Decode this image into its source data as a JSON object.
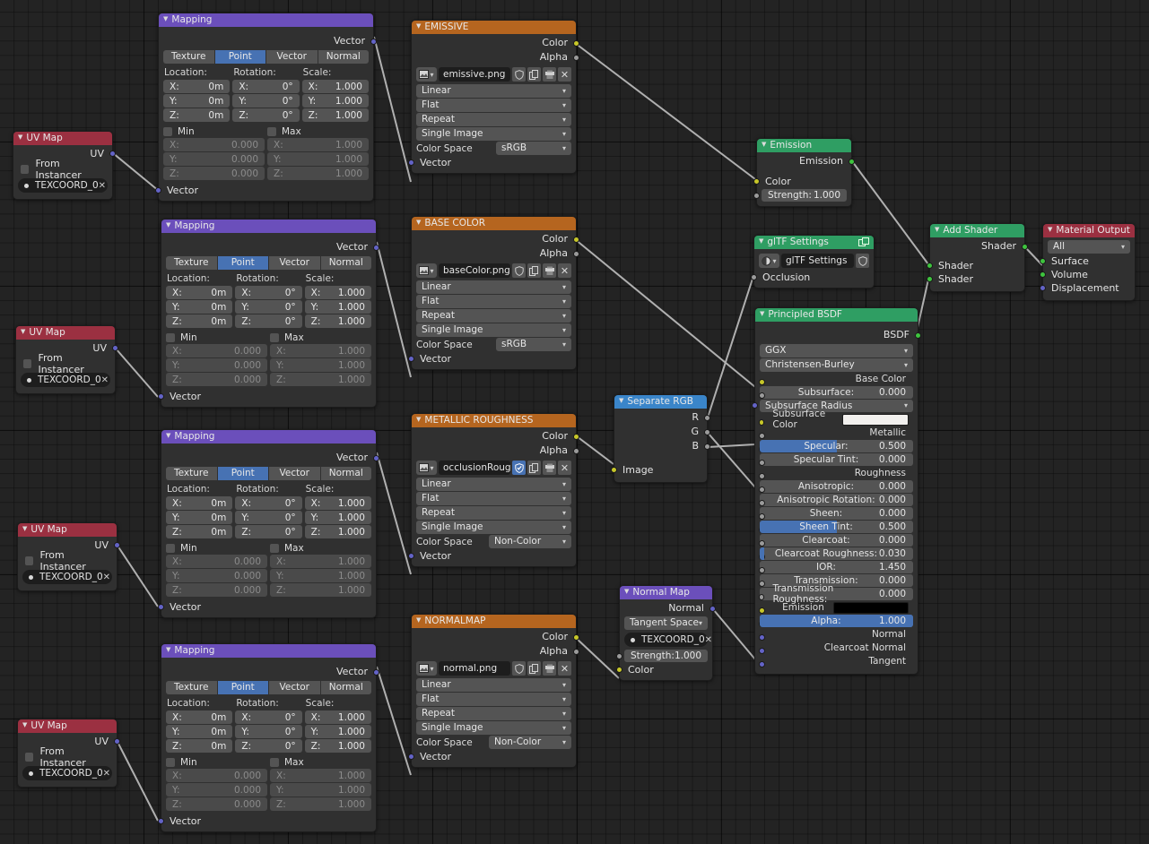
{
  "editor": {
    "name": "blender-shader-node-editor",
    "background": "#232323"
  },
  "colors": {
    "header_mapping": "#6b4fbb",
    "header_uvmap": "#9b3041",
    "header_texture": "#b5651f",
    "header_shader": "#2f9e63",
    "header_output": "#9b3041",
    "header_separate_rgb": "#3a85c9",
    "slider_fill": "#4772b3",
    "wire": "#b0b0b0",
    "socket_color": "#c7c729",
    "socket_value": "#9b9b9b",
    "socket_shader": "#3ec43e",
    "socket_vector": "#6363c7"
  },
  "labels": {
    "vector": "Vector",
    "uv": "UV",
    "color": "Color",
    "alpha": "Alpha",
    "image": "Image",
    "normal": "Normal",
    "shader": "Shader",
    "emission": "Emission",
    "occlusion": "Occlusion",
    "from_instancer": "From Instancer",
    "location": "Location:",
    "rotation": "Rotation:",
    "scale": "Scale:",
    "min": "Min",
    "max": "Max",
    "x": "X:",
    "y": "Y:",
    "z": "Z:",
    "r": "R",
    "g": "G",
    "b": "B",
    "color_space": "Color Space",
    "strength": "Strength:",
    "bsdf": "BSDF"
  },
  "mapping_nodes": [
    {
      "title": "Mapping",
      "tabs": [
        "Texture",
        "Point",
        "Vector",
        "Normal"
      ],
      "active_tab": "Point",
      "location": [
        "0m",
        "0m",
        "0m"
      ],
      "rotation": [
        "0°",
        "0°",
        "0°"
      ],
      "scale": [
        "1.000",
        "1.000",
        "1.000"
      ],
      "min_values": [
        "0.000",
        "0.000",
        "0.000"
      ],
      "max_values": [
        "1.000",
        "1.000",
        "1.000"
      ],
      "min_checked": false,
      "max_checked": false
    },
    {
      "title": "Mapping",
      "tabs": [
        "Texture",
        "Point",
        "Vector",
        "Normal"
      ],
      "active_tab": "Point",
      "location": [
        "0m",
        "0m",
        "0m"
      ],
      "rotation": [
        "0°",
        "0°",
        "0°"
      ],
      "scale": [
        "1.000",
        "1.000",
        "1.000"
      ],
      "min_values": [
        "0.000",
        "0.000",
        "0.000"
      ],
      "max_values": [
        "1.000",
        "1.000",
        "1.000"
      ],
      "min_checked": false,
      "max_checked": false
    },
    {
      "title": "Mapping",
      "tabs": [
        "Texture",
        "Point",
        "Vector",
        "Normal"
      ],
      "active_tab": "Point",
      "location": [
        "0m",
        "0m",
        "0m"
      ],
      "rotation": [
        "0°",
        "0°",
        "0°"
      ],
      "scale": [
        "1.000",
        "1.000",
        "1.000"
      ],
      "min_values": [
        "0.000",
        "0.000",
        "0.000"
      ],
      "max_values": [
        "1.000",
        "1.000",
        "1.000"
      ],
      "min_checked": false,
      "max_checked": false
    },
    {
      "title": "Mapping",
      "tabs": [
        "Texture",
        "Point",
        "Vector",
        "Normal"
      ],
      "active_tab": "Point",
      "location": [
        "0m",
        "0m",
        "0m"
      ],
      "rotation": [
        "0°",
        "0°",
        "0°"
      ],
      "scale": [
        "1.000",
        "1.000",
        "1.000"
      ],
      "min_values": [
        "0.000",
        "0.000",
        "0.000"
      ],
      "max_values": [
        "1.000",
        "1.000",
        "1.000"
      ],
      "min_checked": false,
      "max_checked": false
    }
  ],
  "uv_map_nodes": [
    {
      "title": "UV Map",
      "output": "UV",
      "from_instancer": "From Instancer",
      "uv_layer": "TEXCOORD_0"
    },
    {
      "title": "UV Map",
      "output": "UV",
      "from_instancer": "From Instancer",
      "uv_layer": "TEXCOORD_0"
    },
    {
      "title": "UV Map",
      "output": "UV",
      "from_instancer": "From Instancer",
      "uv_layer": "TEXCOORD_0"
    },
    {
      "title": "UV Map",
      "output": "UV",
      "from_instancer": "From Instancer",
      "uv_layer": "TEXCOORD_0"
    }
  ],
  "texture_nodes": [
    {
      "title": "EMISSIVE",
      "filename": "emissive.png",
      "interpolation": "Linear",
      "projection": "Flat",
      "extension": "Repeat",
      "source": "Single Image",
      "color_space": "sRGB",
      "fake_user": false
    },
    {
      "title": "BASE COLOR",
      "filename": "baseColor.png",
      "interpolation": "Linear",
      "projection": "Flat",
      "extension": "Repeat",
      "source": "Single Image",
      "color_space": "sRGB",
      "fake_user": false
    },
    {
      "title": "METALLIC ROUGHNESS",
      "filename": "occlusionRoughn..",
      "interpolation": "Linear",
      "projection": "Flat",
      "extension": "Repeat",
      "source": "Single Image",
      "color_space": "Non-Color",
      "fake_user": true
    },
    {
      "title": "NORMALMAP",
      "filename": "normal.png",
      "interpolation": "Linear",
      "projection": "Flat",
      "extension": "Repeat",
      "source": "Single Image",
      "color_space": "Non-Color",
      "fake_user": false
    }
  ],
  "emission_node": {
    "title": "Emission",
    "output": "Emission",
    "color_input": "Color",
    "strength_label": "Strength:",
    "strength_value": "1.000"
  },
  "gltf_settings_node": {
    "title": "glTF Settings",
    "group_name": "glTF Settings",
    "input": "Occlusion"
  },
  "separate_rgb_node": {
    "title": "Separate RGB",
    "outputs": [
      "R",
      "G",
      "B"
    ],
    "input": "Image"
  },
  "normal_map_node": {
    "title": "Normal Map",
    "output": "Normal",
    "space": "Tangent Space",
    "uv_layer": "TEXCOORD_0",
    "strength_label": "Strength:",
    "strength_value": "1.000",
    "color_input": "Color"
  },
  "add_shader_node": {
    "title": "Add Shader",
    "output": "Shader",
    "inputs": [
      "Shader",
      "Shader"
    ]
  },
  "material_output_node": {
    "title": "Material Output",
    "target": "All",
    "inputs": [
      "Surface",
      "Volume",
      "Displacement"
    ]
  },
  "principled_bsdf": {
    "title": "Principled BSDF",
    "output": "BSDF",
    "distribution": "GGX",
    "subsurface_method": "Christensen-Burley",
    "properties": [
      {
        "label": "Base Color",
        "value": "",
        "style": "plain",
        "socket": "yellow",
        "fill": 0
      },
      {
        "label": "Subsurface:",
        "value": "0.000",
        "style": "slider",
        "socket": "grey",
        "fill": 0
      },
      {
        "label": "Subsurface Radius",
        "value": "",
        "style": "dropdown",
        "socket": "purple",
        "fill": 0
      },
      {
        "label": "Subsurface Color",
        "value": "",
        "style": "swatch",
        "socket": "yellow",
        "swatch_color": "#f2f0ee"
      },
      {
        "label": "Metallic",
        "value": "",
        "style": "plain",
        "socket": "grey",
        "fill": 0
      },
      {
        "label": "Specular:",
        "value": "0.500",
        "style": "slider",
        "socket": "grey",
        "fill": 50
      },
      {
        "label": "Specular Tint:",
        "value": "0.000",
        "style": "slider",
        "socket": "grey",
        "fill": 0
      },
      {
        "label": "Roughness",
        "value": "",
        "style": "plain",
        "socket": "grey",
        "fill": 0
      },
      {
        "label": "Anisotropic:",
        "value": "0.000",
        "style": "slider",
        "socket": "grey",
        "fill": 0
      },
      {
        "label": "Anisotropic Rotation:",
        "value": "0.000",
        "style": "slider",
        "socket": "grey",
        "fill": 0
      },
      {
        "label": "Sheen:",
        "value": "0.000",
        "style": "slider",
        "socket": "grey",
        "fill": 0
      },
      {
        "label": "Sheen Tint:",
        "value": "0.500",
        "style": "slider",
        "socket": "grey",
        "fill": 50
      },
      {
        "label": "Clearcoat:",
        "value": "0.000",
        "style": "slider",
        "socket": "grey",
        "fill": 0
      },
      {
        "label": "Clearcoat Roughness:",
        "value": "0.030",
        "style": "slider",
        "socket": "grey",
        "fill": 3
      },
      {
        "label": "IOR:",
        "value": "1.450",
        "style": "slider",
        "socket": "grey",
        "fill": 0
      },
      {
        "label": "Transmission:",
        "value": "0.000",
        "style": "slider",
        "socket": "grey",
        "fill": 0
      },
      {
        "label": "Transmission Roughness:",
        "value": "0.000",
        "style": "slider",
        "socket": "grey",
        "fill": 0
      },
      {
        "label": "Emission",
        "value": "",
        "style": "swatch",
        "socket": "yellow",
        "swatch_color": "#000000"
      },
      {
        "label": "Alpha:",
        "value": "1.000",
        "style": "slider",
        "socket": "grey",
        "fill": 100
      },
      {
        "label": "Normal",
        "value": "",
        "style": "plain",
        "socket": "purple",
        "fill": 0
      },
      {
        "label": "Clearcoat Normal",
        "value": "",
        "style": "plain",
        "socket": "purple",
        "fill": 0
      },
      {
        "label": "Tangent",
        "value": "",
        "style": "plain",
        "socket": "purple",
        "fill": 0
      }
    ]
  }
}
